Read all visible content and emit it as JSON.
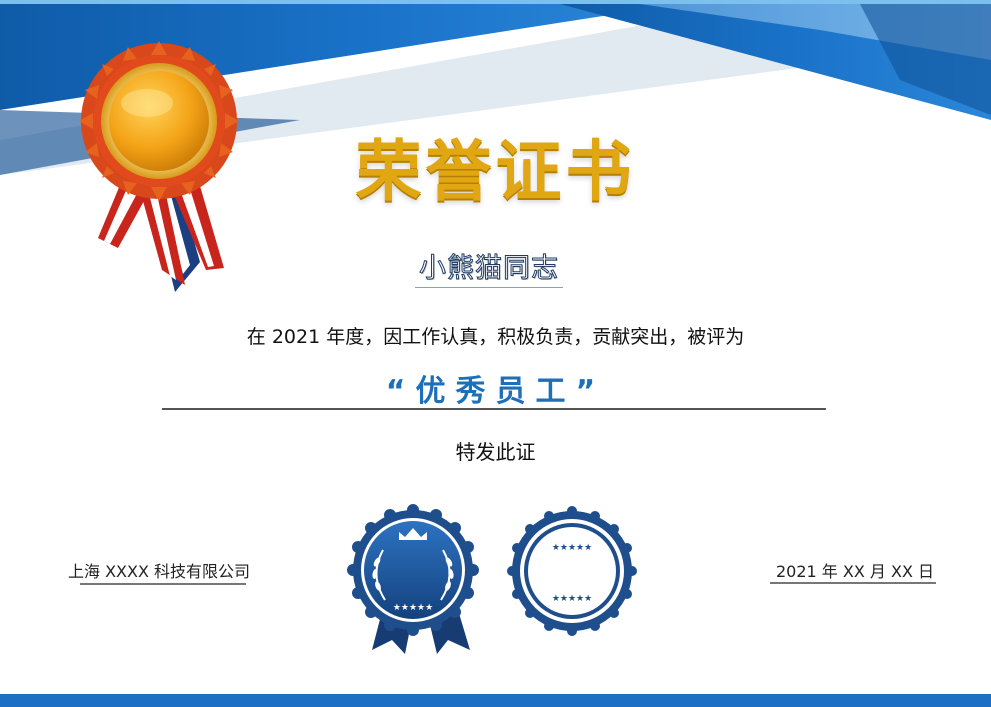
{
  "certificate": {
    "title": "荣誉证书",
    "recipient": "小熊猫同志",
    "body_text": "在 2021 年度，因工作认真，积极负责，贡献突出，被评为",
    "award": "“优秀员工”",
    "closing": "特发此证",
    "company": "上海 XXXX 科技有限公司",
    "date": "2021 年 XX 月 XX 日"
  },
  "colors": {
    "accent_blue": "#1e6fb9",
    "banner_blue": "#1565c0",
    "title_gold": "#e0a712",
    "seal_navy": "#1f4e8c"
  },
  "icons": [
    "medal-ribbon-icon",
    "crown-icon",
    "laurel-wreath-icon",
    "star-icon"
  ]
}
